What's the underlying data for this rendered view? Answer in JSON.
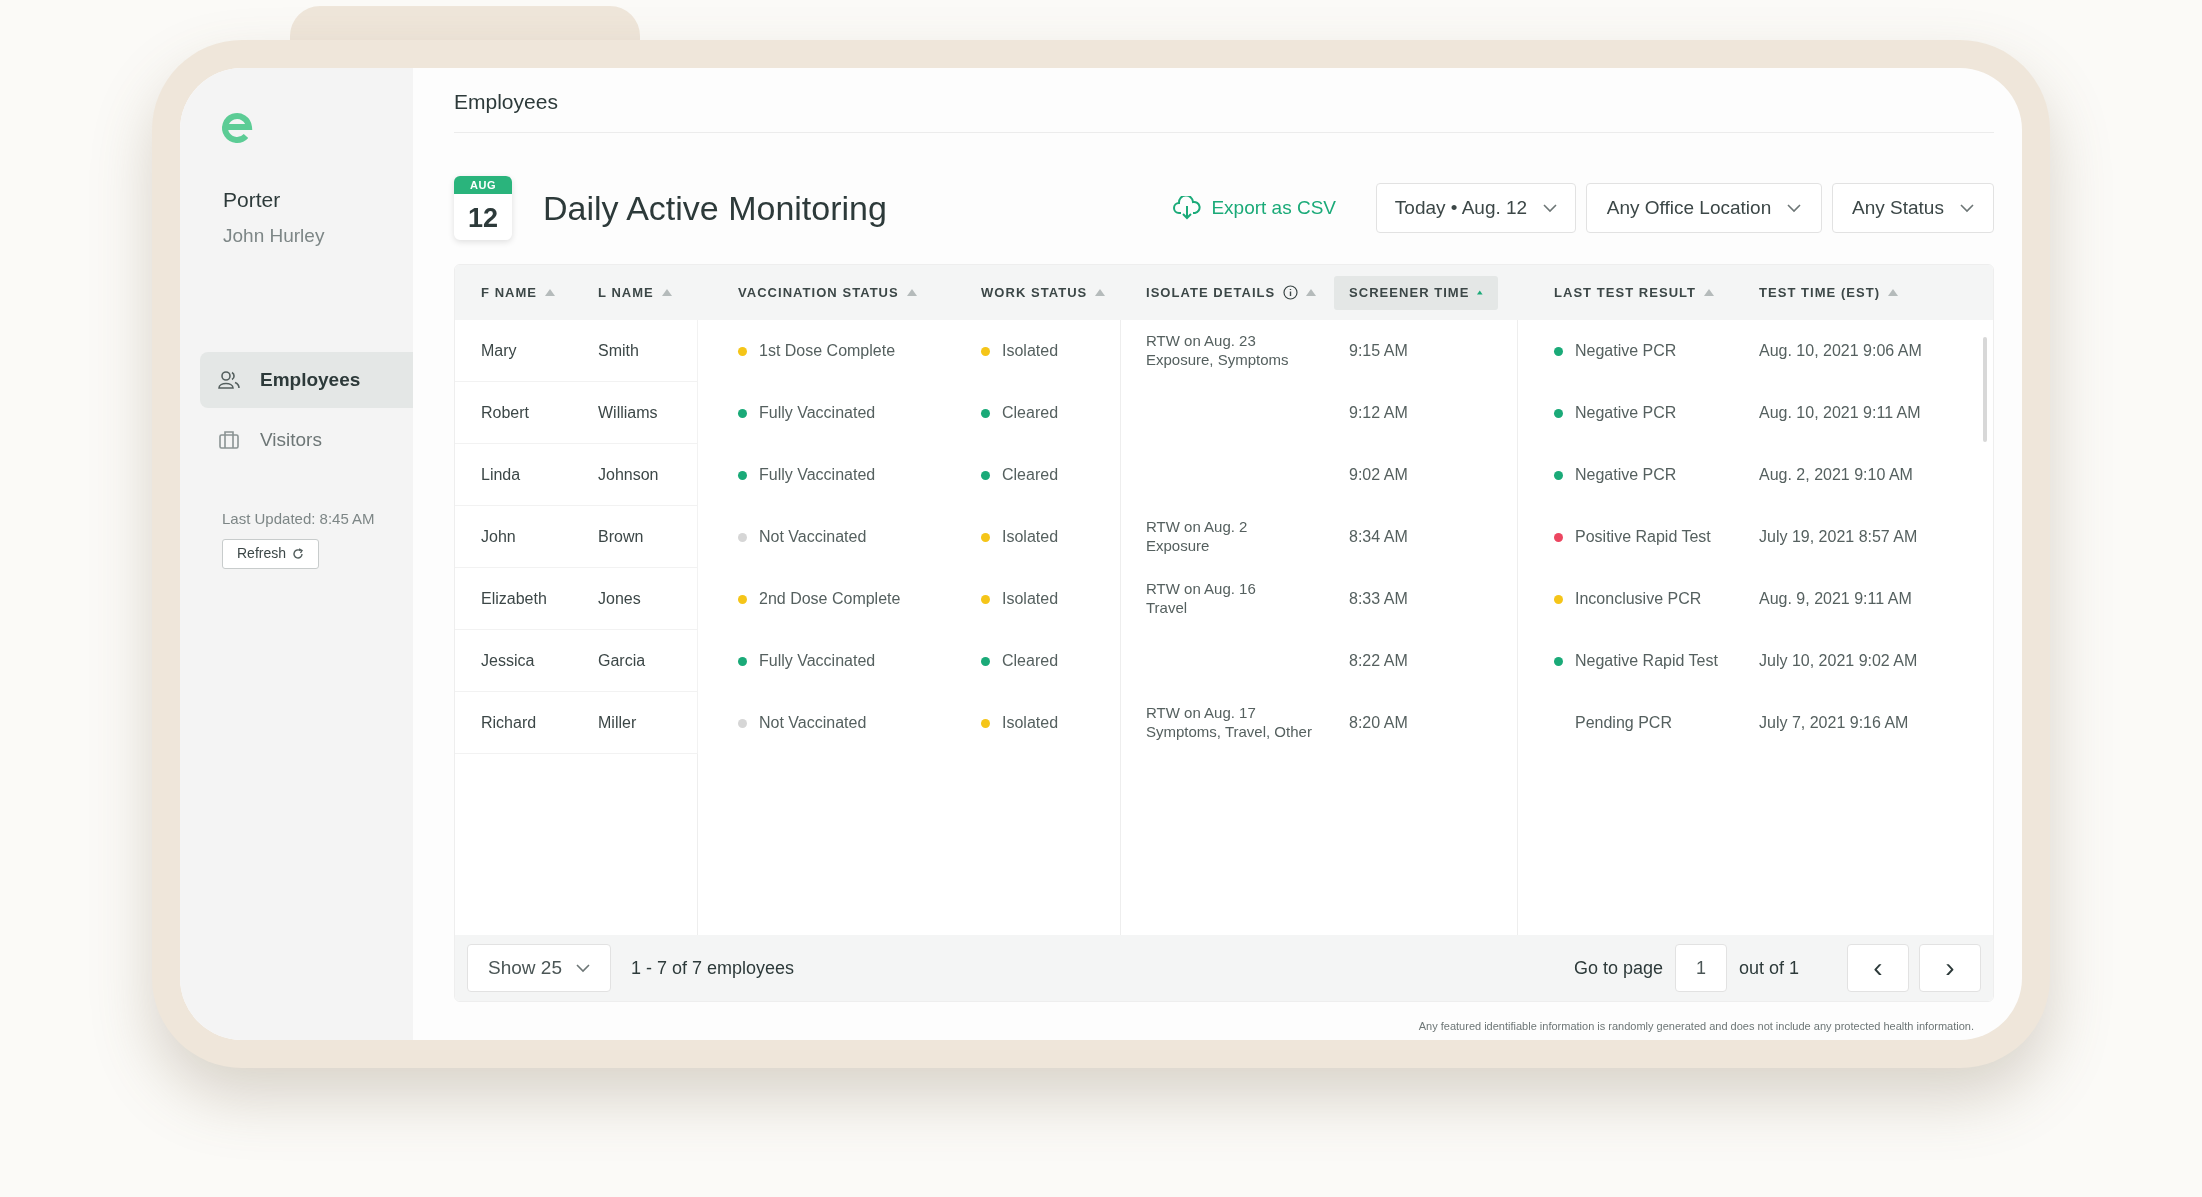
{
  "page_title": "Employees",
  "sidebar": {
    "org": "Porter",
    "user": "John Hurley",
    "items": [
      {
        "label": "Employees",
        "kind": "people",
        "selected": true
      },
      {
        "label": "Visitors",
        "kind": "building",
        "selected": false
      }
    ],
    "last_updated": "Last Updated: 8:45 AM",
    "refresh": "Refresh"
  },
  "header": {
    "date_month": "AUG",
    "date_day": "12",
    "title": "Daily Active Monitoring",
    "export": "Export as CSV",
    "filters": [
      "Today • Aug. 12",
      "Any Office Location",
      "Any Status"
    ]
  },
  "table": {
    "columns": [
      {
        "label": "F NAME",
        "selected": false
      },
      {
        "label": "L NAME",
        "selected": false
      },
      {
        "label": "VACCINATION STATUS",
        "selected": false
      },
      {
        "label": "WORK STATUS",
        "selected": false
      },
      {
        "label": "ISOLATE DETAILS",
        "selected": false,
        "info": true
      },
      {
        "label": "SCREENER TIME",
        "selected": true
      },
      {
        "label": "LAST TEST RESULT",
        "selected": false
      },
      {
        "label": "TEST TIME (EST)",
        "selected": false
      }
    ],
    "rows": [
      {
        "first": "Mary",
        "last": "Smith",
        "vaccination": {
          "text": "1st Dose Complete",
          "color": "#f5c518"
        },
        "work": {
          "text": "Isolated",
          "color": "#f5c518"
        },
        "isolate": [
          "RTW on Aug. 23",
          "Exposure, Symptoms"
        ],
        "screener": "9:15 AM",
        "test": {
          "text": "Negative PCR",
          "color": "#1aaa78"
        },
        "test_time": "Aug. 10, 2021 9:06 AM"
      },
      {
        "first": "Robert",
        "last": "Williams",
        "vaccination": {
          "text": "Fully Vaccinated",
          "color": "#1aaa78"
        },
        "work": {
          "text": "Cleared",
          "color": "#1aaa78"
        },
        "isolate": [],
        "screener": "9:12 AM",
        "test": {
          "text": "Negative PCR",
          "color": "#1aaa78"
        },
        "test_time": "Aug. 10, 2021 9:11 AM"
      },
      {
        "first": "Linda",
        "last": "Johnson",
        "vaccination": {
          "text": "Fully Vaccinated",
          "color": "#1aaa78"
        },
        "work": {
          "text": "Cleared",
          "color": "#1aaa78"
        },
        "isolate": [],
        "screener": "9:02 AM",
        "test": {
          "text": "Negative PCR",
          "color": "#1aaa78"
        },
        "test_time": "Aug. 2, 2021 9:10 AM"
      },
      {
        "first": "John",
        "last": "Brown",
        "vaccination": {
          "text": "Not Vaccinated",
          "color": "#d6d6d6"
        },
        "work": {
          "text": "Isolated",
          "color": "#f5c518"
        },
        "isolate": [
          "RTW on Aug. 2",
          "Exposure"
        ],
        "screener": "8:34 AM",
        "test": {
          "text": "Positive Rapid Test",
          "color": "#ec4660"
        },
        "test_time": "July 19, 2021 8:57 AM"
      },
      {
        "first": "Elizabeth",
        "last": "Jones",
        "vaccination": {
          "text": "2nd Dose Complete",
          "color": "#f5c518"
        },
        "work": {
          "text": "Isolated",
          "color": "#f5c518"
        },
        "isolate": [
          "RTW on Aug. 16",
          "Travel"
        ],
        "screener": "8:33 AM",
        "test": {
          "text": "Inconclusive PCR",
          "color": "#f5c518"
        },
        "test_time": "Aug. 9, 2021 9:11 AM"
      },
      {
        "first": "Jessica",
        "last": "Garcia",
        "vaccination": {
          "text": "Fully Vaccinated",
          "color": "#1aaa78"
        },
        "work": {
          "text": "Cleared",
          "color": "#1aaa78"
        },
        "isolate": [],
        "screener": "8:22 AM",
        "test": {
          "text": "Negative Rapid Test",
          "color": "#1aaa78"
        },
        "test_time": "July 10, 2021 9:02 AM"
      },
      {
        "first": "Richard",
        "last": "Miller",
        "vaccination": {
          "text": "Not Vaccinated",
          "color": "#d6d6d6"
        },
        "work": {
          "text": "Isolated",
          "color": "#f5c518"
        },
        "isolate": [
          "RTW on Aug. 17",
          "Symptoms, Travel, Other"
        ],
        "screener": "8:20 AM",
        "test": {
          "text": "Pending PCR"
        },
        "test_time": "July 7, 2021 9:16 AM"
      }
    ]
  },
  "footer": {
    "page_size": "Show 25",
    "count": "1 - 7 of 7 employees",
    "go_to": "Go to page",
    "page": "1",
    "out_of": "out of 1",
    "prev": "‹",
    "next": "›"
  },
  "disclaimer": "Any featured identifiable information is randomly generated and does not include any protected health information."
}
